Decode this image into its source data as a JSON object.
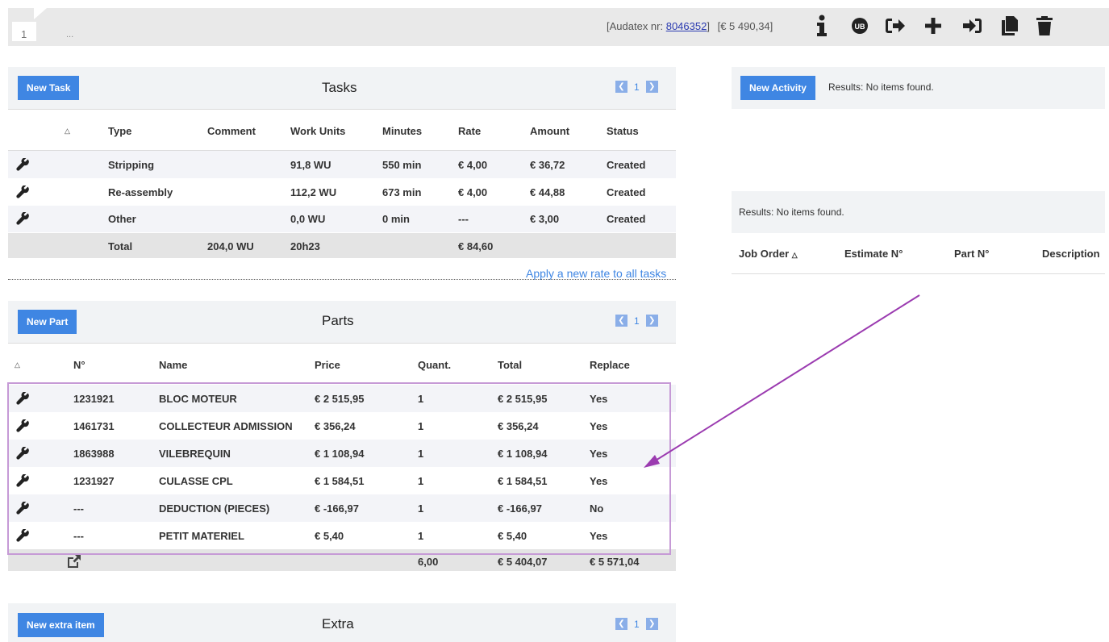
{
  "topbar": {
    "row_number": "1",
    "ellipsis": "...",
    "audatex_prefix": "[Audatex nr: ",
    "audatex_number": "8046352",
    "audatex_suffix": "]",
    "total": "[€ 5 490,34]",
    "icons": [
      "info-icon",
      "ub-icon",
      "sign-out-icon",
      "plus-icon",
      "sign-in-icon",
      "copy-icon",
      "trash-icon"
    ]
  },
  "tasks": {
    "new_label": "New Task",
    "title": "Tasks",
    "page": "1",
    "columns": [
      "Type",
      "Comment",
      "Work Units",
      "Minutes",
      "Rate",
      "Amount",
      "Status"
    ],
    "rows": [
      {
        "type": "Stripping",
        "comment": "",
        "wu": "91,8 WU",
        "minutes": "550 min",
        "rate": "€ 4,00",
        "amount": "€ 36,72",
        "status": "Created"
      },
      {
        "type": "Re-assembly",
        "comment": "",
        "wu": "112,2 WU",
        "minutes": "673 min",
        "rate": "€ 4,00",
        "amount": "€ 44,88",
        "status": "Created"
      },
      {
        "type": "Other",
        "comment": "",
        "wu": "0,0 WU",
        "minutes": "0 min",
        "rate": "---",
        "amount": "€ 3,00",
        "status": "Created"
      }
    ],
    "total": {
      "label": "Total",
      "wu": "204,0 WU",
      "minutes": "20h23",
      "amount": "€ 84,60"
    },
    "apply_link": "Apply a new rate to all tasks"
  },
  "parts": {
    "new_label": "New Part",
    "title": "Parts",
    "page": "1",
    "columns": [
      "N°",
      "Name",
      "Price",
      "Quant.",
      "Total",
      "Replace"
    ],
    "rows": [
      {
        "no": "1231921",
        "name": "BLOC MOTEUR",
        "price": "€ 2 515,95",
        "qty": "1",
        "total": "€ 2 515,95",
        "replace": "Yes"
      },
      {
        "no": "1461731",
        "name": "COLLECTEUR ADMISSION",
        "price": "€ 356,24",
        "qty": "1",
        "total": "€ 356,24",
        "replace": "Yes"
      },
      {
        "no": "1863988",
        "name": "VILEBREQUIN",
        "price": "€ 1 108,94",
        "qty": "1",
        "total": "€ 1 108,94",
        "replace": "Yes"
      },
      {
        "no": "1231927",
        "name": "CULASSE CPL",
        "price": "€ 1 584,51",
        "qty": "1",
        "total": "€ 1 584,51",
        "replace": "Yes"
      },
      {
        "no": "---",
        "name": "DEDUCTION (PIECES)",
        "price": "€ -166,97",
        "qty": "1",
        "total": "€ -166,97",
        "replace": "No"
      },
      {
        "no": "---",
        "name": "PETIT MATERIEL",
        "price": "€ 5,40",
        "qty": "1",
        "total": "€ 5,40",
        "replace": "Yes"
      }
    ],
    "total": {
      "qty": "6,00",
      "total": "€ 5 404,07",
      "replace": "€ 5 571,04"
    }
  },
  "extra": {
    "new_label": "New extra item",
    "title": "Extra",
    "page": "1"
  },
  "activity": {
    "new_label": "New Activity",
    "results": "Results: No items found."
  },
  "joborders": {
    "results": "Results: No items found.",
    "columns": [
      "Job Order",
      "Estimate N°",
      "Part N°",
      "Description"
    ]
  },
  "colors": {
    "accent": "#3f86e3",
    "highlight": "#c69ad6",
    "arrow": "#9b3bb0"
  }
}
